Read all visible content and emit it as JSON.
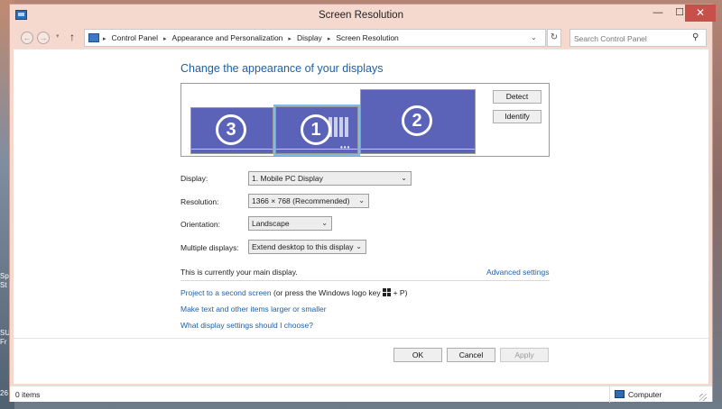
{
  "desktop": {
    "fragments": [
      "Sp",
      "St",
      "SU",
      "Fr",
      "26"
    ]
  },
  "window": {
    "title": "Screen Resolution",
    "minimize_glyph": "—",
    "maximize_glyph": "☐",
    "close_glyph": "✕"
  },
  "address_bar": {
    "back_glyph": "←",
    "forward_glyph": "→",
    "dropdown_glyph": "▾",
    "up_glyph": "↑",
    "breadcrumbs": [
      "Control Panel",
      "Appearance and Personalization",
      "Display",
      "Screen Resolution"
    ],
    "separator": "▸",
    "address_dropdown_glyph": "⌄",
    "refresh_glyph": "↻",
    "search_placeholder": "Search Control Panel",
    "search_glyph": "⚲"
  },
  "main": {
    "heading": "Change the appearance of your displays",
    "monitors": [
      {
        "number": "3"
      },
      {
        "number": "1"
      },
      {
        "number": "2"
      }
    ],
    "detect_label": "Detect",
    "identify_label": "Identify",
    "display_label": "Display:",
    "display_value": "1. Mobile PC Display",
    "resolution_label": "Resolution:",
    "resolution_value": "1366 × 768 (Recommended)",
    "orientation_label": "Orientation:",
    "orientation_value": "Landscape",
    "multiple_label": "Multiple displays:",
    "multiple_value": "Extend desktop to this display",
    "chevron": "⌄",
    "main_display_text": "This is currently your main display.",
    "advanced_settings": "Advanced settings",
    "project_link": "Project to a second screen",
    "project_suffix_before": "(or press the Windows logo key",
    "project_suffix_after": "+ P)",
    "larger_link": "Make text and other items larger or smaller",
    "settings_help_link": "What display settings should I choose?",
    "ok_label": "OK",
    "cancel_label": "Cancel",
    "apply_label": "Apply"
  },
  "status_bar": {
    "items": "0 items",
    "location": "Computer"
  },
  "colors": {
    "link": "#1e5fa8",
    "monitor_fill": "#5a63b8",
    "close_button": "#c7504b",
    "title_bar": "#f5d9cf"
  }
}
